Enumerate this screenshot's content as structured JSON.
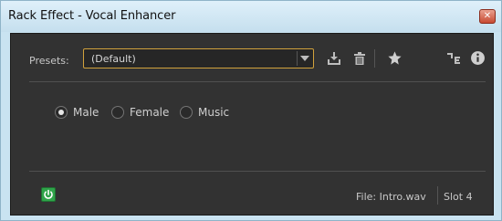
{
  "window": {
    "title": "Rack Effect - Vocal Enhancer",
    "close_label": "✕"
  },
  "presets": {
    "label": "Presets:",
    "selected": "(Default)"
  },
  "toolbar": {
    "icons": [
      "save-preset-icon",
      "delete-preset-icon",
      "favorite-star-icon",
      "route-channels-icon",
      "info-icon"
    ]
  },
  "modes": [
    {
      "label": "Male",
      "checked": true
    },
    {
      "label": "Female",
      "checked": false
    },
    {
      "label": "Music",
      "checked": false
    }
  ],
  "footer": {
    "power_on": true,
    "file_label": "File: Intro.wav",
    "slot_label": "Slot 4"
  },
  "colors": {
    "panel_bg": "#323232",
    "select_border": "#d1a13c",
    "power_green": "#2fa44a",
    "frame_blue": "#c9e3f1"
  }
}
